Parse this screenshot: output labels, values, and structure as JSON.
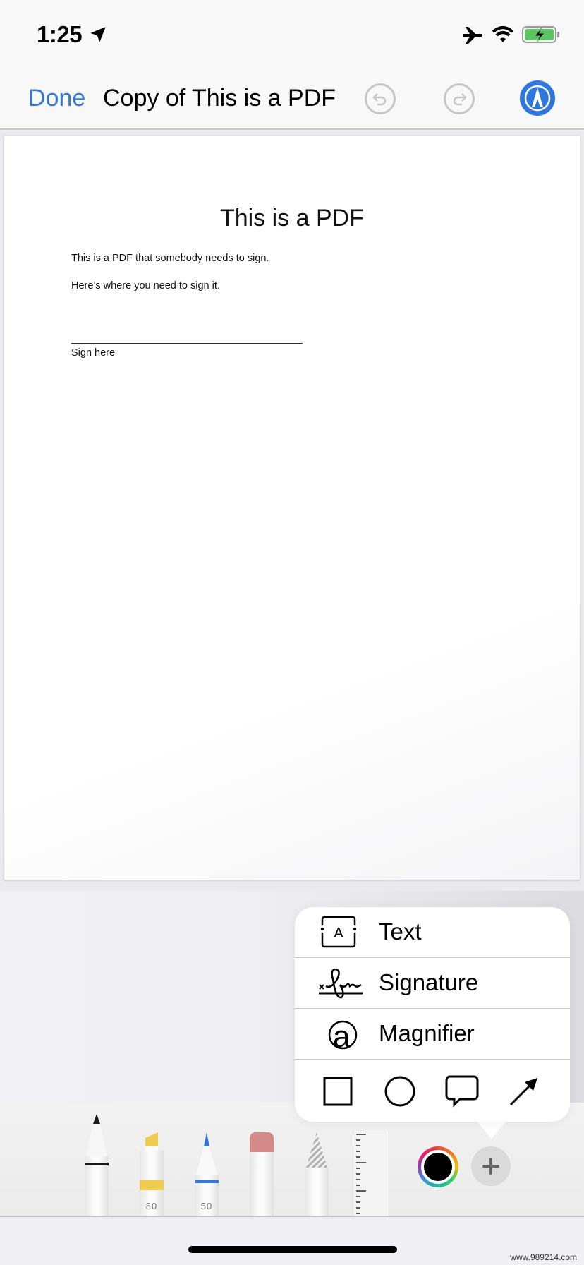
{
  "status_bar": {
    "time": "1:25",
    "icons": [
      "location-arrow-icon",
      "airplane-mode-icon",
      "wifi-icon",
      "battery-charging-icon"
    ]
  },
  "nav": {
    "done_label": "Done",
    "title": "Copy of This is a PDF",
    "undo_icon": "undo-icon",
    "redo_icon": "redo-icon",
    "markup_icon": "markup-pen-icon",
    "accent_color": "#3478d6"
  },
  "document": {
    "heading": "This is a PDF",
    "paragraphs": [
      "This is a PDF that somebody needs to sign.",
      "Here’s where you need to sign it."
    ],
    "signature_caption": "Sign here"
  },
  "tools": {
    "items": [
      {
        "name": "pen",
        "color": "#1a1a1a"
      },
      {
        "name": "highlighter",
        "color": "#efcb4f",
        "value": "80"
      },
      {
        "name": "pencil",
        "color": "#2f76dd",
        "value": "50"
      },
      {
        "name": "eraser",
        "color": "#d68a88"
      },
      {
        "name": "lasso"
      },
      {
        "name": "ruler"
      }
    ],
    "current_color": "#000000",
    "add_icon": "plus-icon"
  },
  "popover": {
    "items": [
      {
        "label": "Text",
        "icon": "text-box-icon"
      },
      {
        "label": "Signature",
        "icon": "signature-icon"
      },
      {
        "label": "Magnifier",
        "icon": "magnifier-icon"
      }
    ],
    "shapes": [
      "square-shape-icon",
      "circle-shape-icon",
      "speech-bubble-icon",
      "arrow-icon"
    ]
  },
  "watermark": "www.989214.com"
}
